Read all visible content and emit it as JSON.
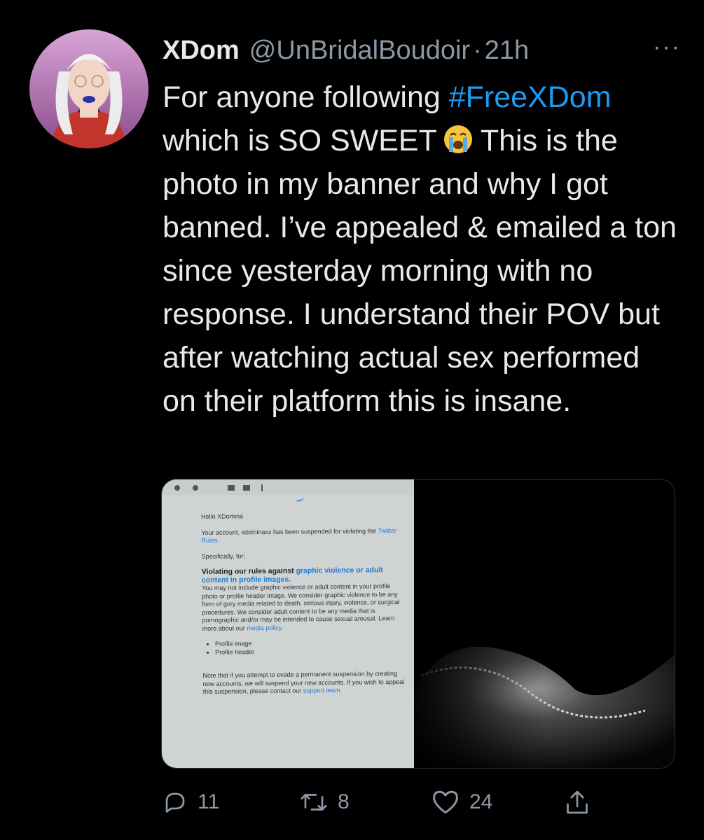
{
  "tweet": {
    "author_name": "XDom",
    "handle": "@UnBridalBoudoir",
    "separator": "·",
    "time": "21h",
    "more_label": "···",
    "text_part1": "For anyone following ",
    "hashtag": "#FreeXDom",
    "text_part2": " which is SO SWEET",
    "text_part3": "This is the photo in my banner and why I got banned. I’ve appealed & emailed a ton since yesterday morning with no response. I understand their POV but after watching actual sex performed on their platform this is insane."
  },
  "media": {
    "email": {
      "greeting": "Hello XDomina",
      "line1": "Your account, xdominaxx has been suspended for violating the",
      "rules_link": "Twitter Rules.",
      "specifically": "Specifically, for:",
      "heading_a": "Violating our rules against",
      "heading_link": "graphic violence or adult content in profile images.",
      "body": "You may not include graphic violence or adult content in your profile photo or profile header image. We consider graphic violence to be any form of gory media related to death, serious injury, violence, or surgical procedures. We consider adult content to be any media that is pornographic and/or may be intended to cause sexual arousal. Learn more about our",
      "media_link": "media policy.",
      "bullets": [
        "Profile image",
        "Profile header"
      ],
      "note": "Note that if you attempt to evade a permanent suspension by creating new accounts, we will suspend your new accounts. If you wish to appeal this suspension, please contact our",
      "support_link": "support team."
    }
  },
  "actions": {
    "replies": "11",
    "retweets": "8",
    "likes": "24"
  },
  "colors": {
    "background": "#000000",
    "text": "#e7e9ea",
    "secondary": "#8b98a5",
    "accent": "#1d9bf0"
  },
  "icons": [
    "reply-icon",
    "retweet-icon",
    "like-icon",
    "share-icon",
    "crying-face-emoji"
  ]
}
